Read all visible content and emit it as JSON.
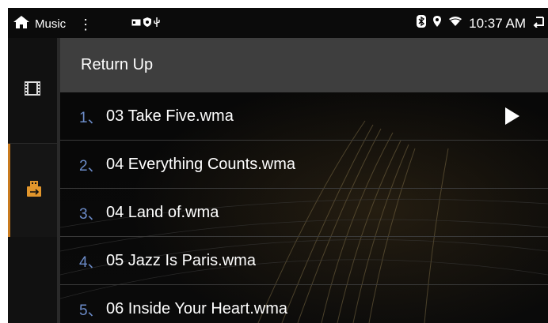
{
  "status_bar": {
    "app_title": "Music",
    "time": "10:37 AM"
  },
  "list": {
    "return_label": "Return Up",
    "items": [
      {
        "num": "1、",
        "name": "03 Take Five.wma"
      },
      {
        "num": "2、",
        "name": "04 Everything Counts.wma"
      },
      {
        "num": "3、",
        "name": "04 Land of.wma"
      },
      {
        "num": "4、",
        "name": "05 Jazz Is Paris.wma"
      },
      {
        "num": "5、",
        "name": "06 Inside Your Heart.wma"
      }
    ],
    "playing_index": 0
  },
  "colors": {
    "accent": "#c87a1e",
    "number": "#6c8cc9",
    "return_bar": "#3e3e3e"
  },
  "icons": [
    "home-icon",
    "more-vert-icon",
    "bluetooth-icon",
    "location-icon",
    "wifi-icon",
    "back-icon",
    "video-icon",
    "usb-icon",
    "play-icon"
  ]
}
